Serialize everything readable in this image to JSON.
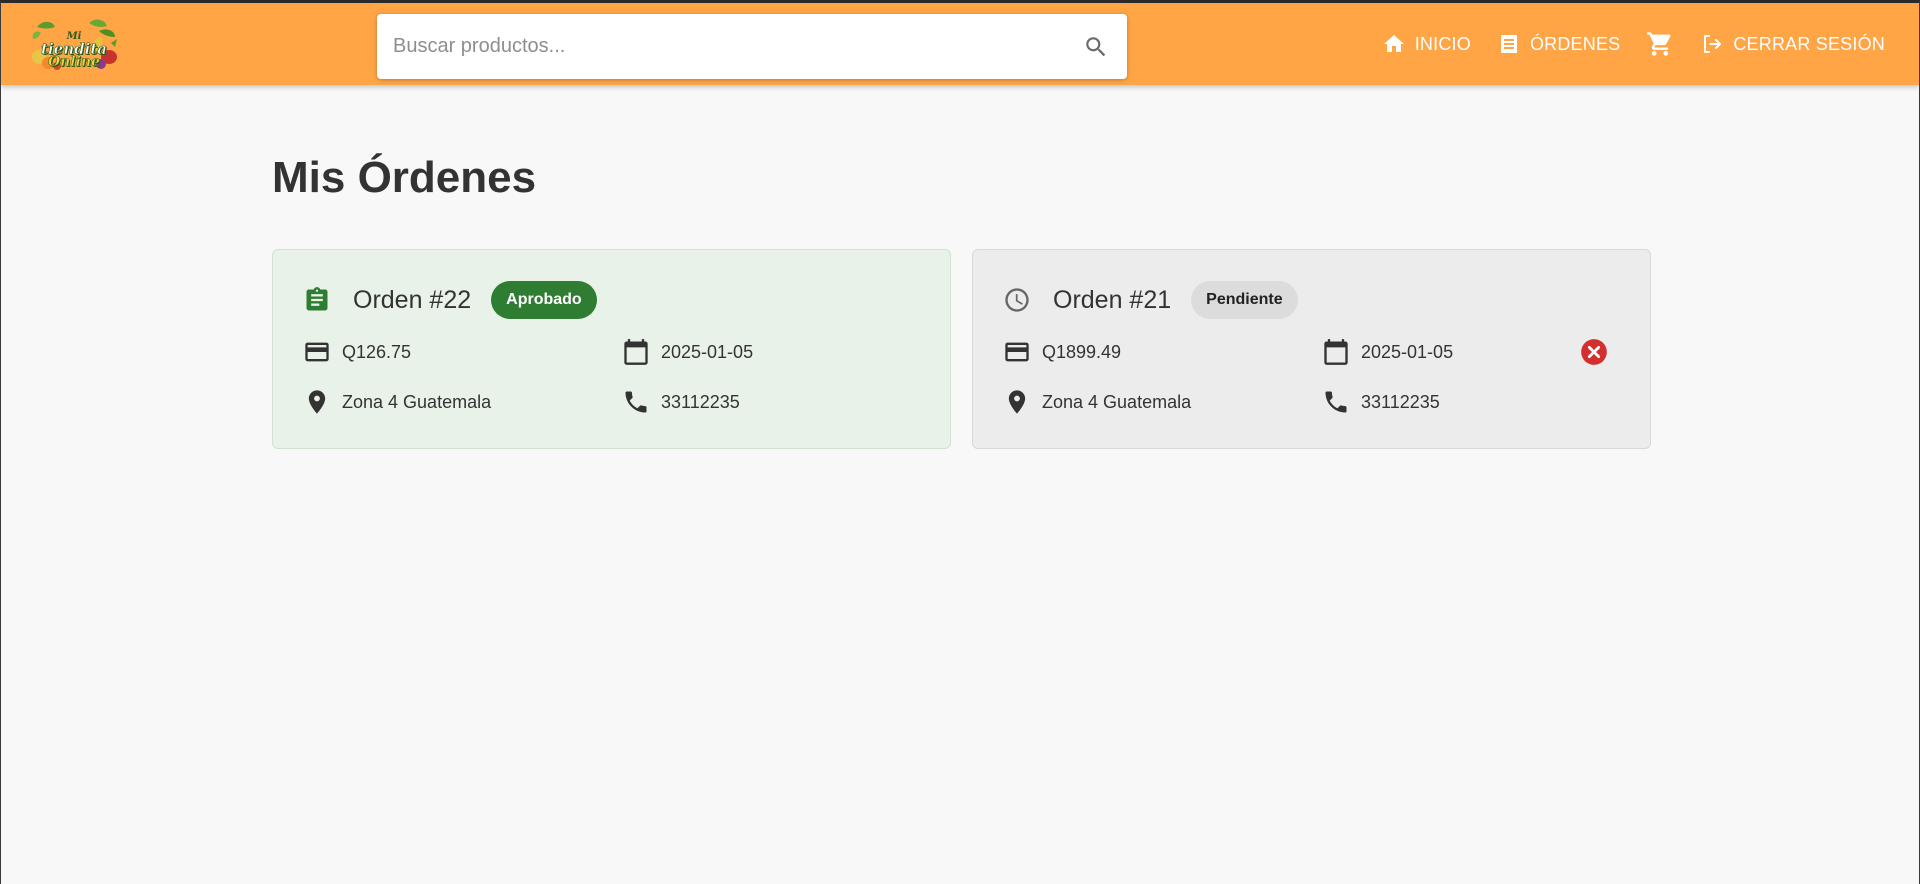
{
  "header": {
    "logo": {
      "line1": "Mi",
      "line2": "tiendita",
      "line3": "Online"
    },
    "search": {
      "placeholder": "Buscar productos...",
      "value": ""
    },
    "nav": {
      "home_label": "INICIO",
      "orders_label": "ÓRDENES",
      "logout_label": "CERRAR SESIÓN"
    },
    "colors": {
      "bar": "#ffa545"
    }
  },
  "main": {
    "title": "Mis Órdenes",
    "orders": [
      {
        "title": "Orden #22",
        "status": "Aprobado",
        "status_icon": "clipboard-icon",
        "total": "Q126.75",
        "date": "2025-01-05",
        "address": "Zona 4 Guatemala",
        "phone": "33112235",
        "card_color": "#e8f2e8",
        "badge_color": "#2f7d32"
      },
      {
        "title": "Orden #21",
        "status": "Pendiente",
        "status_icon": "clock-icon",
        "total": "Q1899.49",
        "date": "2025-01-05",
        "address": "Zona 4 Guatemala",
        "phone": "33112235",
        "card_color": "#ececec",
        "badge_color": "#dcdcdc",
        "cancel_icon": "cancel-icon"
      }
    ]
  }
}
